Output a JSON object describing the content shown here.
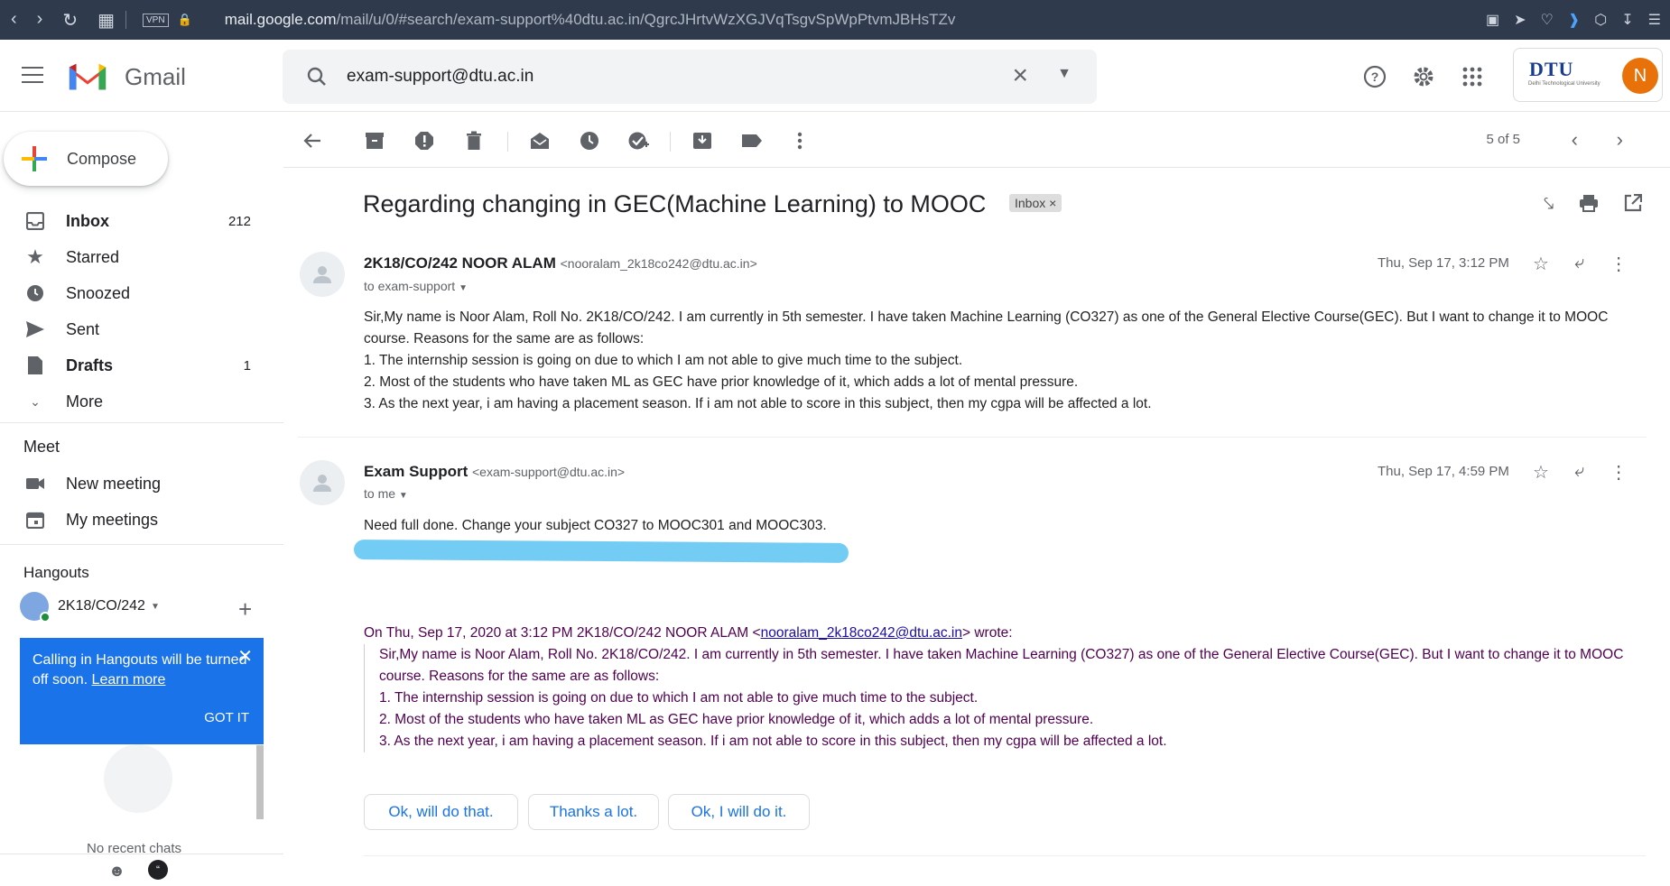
{
  "browser": {
    "vpn": "VPN",
    "url_host": "mail.google.com",
    "url_path": "/mail/u/0/#search/exam-support%40dtu.ac.in/QgrcJHrtvWzXGJVqTsgvSpWpPtvmJBHsTZv"
  },
  "header": {
    "app_name": "Gmail",
    "search_value": "exam-support@dtu.ac.in",
    "org_logo_text": "DTU",
    "org_logo_subtitle": "Delhi Technological University",
    "avatar_letter": "N"
  },
  "sidebar": {
    "compose": "Compose",
    "items": [
      {
        "label": "Inbox",
        "count": "212",
        "icon": "inbox-icon"
      },
      {
        "label": "Starred",
        "count": "",
        "icon": "star-icon"
      },
      {
        "label": "Snoozed",
        "count": "",
        "icon": "clock-icon"
      },
      {
        "label": "Sent",
        "count": "",
        "icon": "send-icon"
      },
      {
        "label": "Drafts",
        "count": "1",
        "icon": "draft-icon"
      },
      {
        "label": "More",
        "count": "",
        "icon": "chevron-down-icon"
      }
    ],
    "meet_title": "Meet",
    "meet_items": [
      {
        "label": "New meeting",
        "icon": "video-icon"
      },
      {
        "label": "My meetings",
        "icon": "calendar-icon"
      }
    ],
    "hangouts_title": "Hangouts",
    "hangouts_user": "2K18/CO/242",
    "toast_text": "Calling in Hangouts will be turned off soon.",
    "toast_link": "Learn more",
    "toast_button": "GOT IT",
    "no_chats": "No recent chats"
  },
  "toolbar": {
    "pager": "5 of 5"
  },
  "email": {
    "subject": "Regarding changing in GEC(Machine Learning) to MOOC",
    "label": "Inbox",
    "messages": [
      {
        "sender_name": "2K18/CO/242 NOOR ALAM",
        "sender_email": "<nooralam_2k18co242@dtu.ac.in>",
        "to": "to exam-support",
        "date": "Thu, Sep 17, 3:12 PM",
        "lines": [
          "Sir,My name is Noor Alam, Roll No. 2K18/CO/242. I am currently in 5th semester. I have taken Machine Learning (CO327) as one of the General Elective Course(GEC). But I want to change it to MOOC course. Reasons for the same are as follows:",
          "1. The internship session is going on due to which I am not able to give much time to the subject.",
          "2. Most of the students who have taken ML as GEC have prior knowledge of it, which adds a lot of mental pressure.",
          "3. As the next year, i am having a placement season. If i am not able to score in this subject, then my cgpa will be affected a lot."
        ]
      },
      {
        "sender_name": "Exam Support",
        "sender_email": "<exam-support@dtu.ac.in>",
        "to": "to me",
        "date": "Thu, Sep 17, 4:59 PM",
        "lines": [
          "Need full done. Change your subject CO327 to MOOC301 and MOOC303."
        ]
      }
    ],
    "quote_head_pre": "On Thu, Sep 17, 2020 at 3:12 PM 2K18/CO/242 NOOR ALAM <",
    "quote_head_link": "nooralam_2k18co242@dtu.ac.in",
    "quote_head_post": "> wrote:",
    "quote_lines": [
      "Sir,My name is Noor Alam, Roll No. 2K18/CO/242. I am currently in 5th semester. I have taken Machine Learning (CO327) as one of the General Elective Course(GEC). But I want to change it to MOOC course. Reasons for the same are as follows:",
      "1. The internship session is going on due to which I am not able to give much time to the subject.",
      "2. Most of the students who have taken ML as GEC have prior knowledge of it, which adds a lot of mental pressure.",
      "3. As the next year, i am having a placement season. If i am not able to score in this subject, then my cgpa will be affected a lot."
    ],
    "smart_replies": [
      "Ok, will do that.",
      "Thanks a lot.",
      "Ok, I will do it."
    ]
  },
  "colors": {
    "accent": "#1a73e8",
    "highlight": "#63c7f2",
    "quote": "#500050"
  }
}
